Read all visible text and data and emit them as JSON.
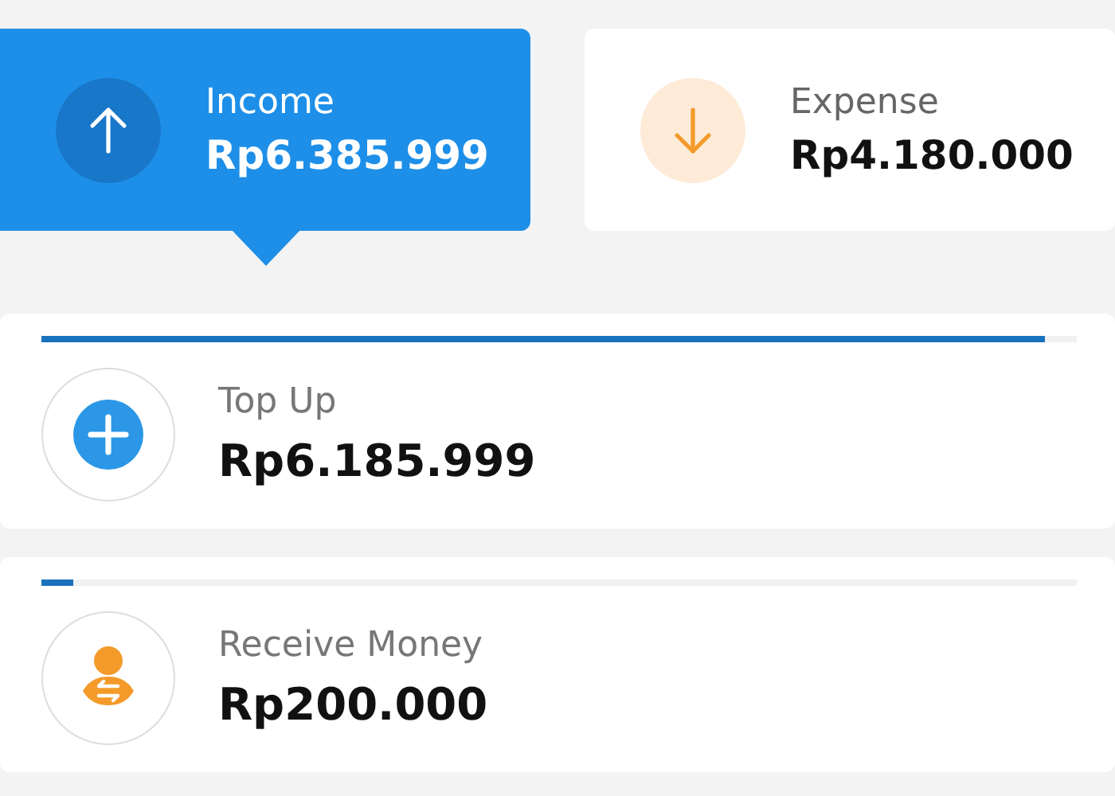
{
  "summary_tabs": [
    {
      "kind": "income",
      "label": "Income",
      "amount": "Rp6.385.999",
      "selected": true
    },
    {
      "kind": "expense",
      "label": "Expense",
      "amount": "Rp4.180.000",
      "selected": false
    }
  ],
  "entries": [
    {
      "kind": "top_up",
      "label": "Top Up",
      "amount": "Rp6.185.999",
      "level": 0.969
    },
    {
      "kind": "receive",
      "label": "Receive Money",
      "amount": "Rp200.000",
      "level": 0.031
    }
  ]
}
